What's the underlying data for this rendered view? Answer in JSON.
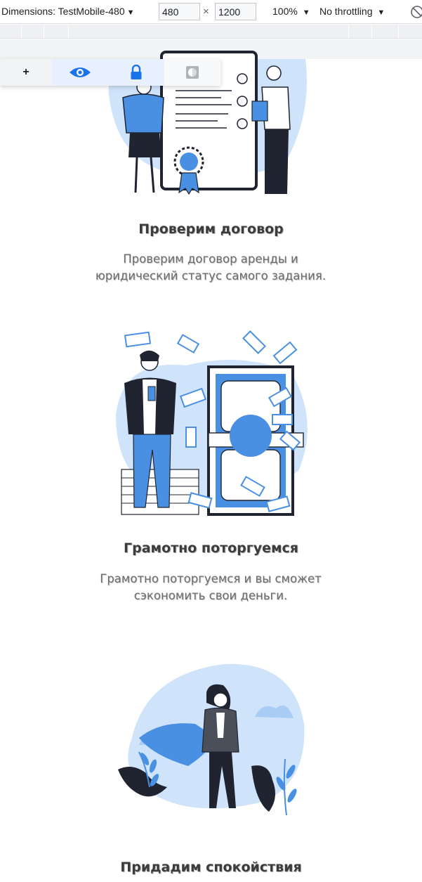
{
  "devtools": {
    "dimensions_label": "Dimensions: TestMobile-480",
    "width_value": "480",
    "height_value": "1200",
    "times": "×",
    "zoom": "100%",
    "throttling": "No throttling",
    "dropdown_arrow": "▼"
  },
  "tools": {
    "plus_label": "+",
    "items": [
      "plus-icon",
      "eye-icon",
      "lock-icon",
      "contrast-icon"
    ]
  },
  "features": [
    {
      "title": "Проверим договор",
      "desc_line1": "Проверим договор аренды и",
      "desc_line2": "юридический статус самого задания."
    },
    {
      "title": "Грамотно поторгуемся",
      "desc_line1": "Грамотно поторгуемся и вы сможет",
      "desc_line2": "сэкономить свои деньги."
    },
    {
      "title": "Придадим спокойствия"
    }
  ],
  "colors": {
    "accent": "#1a73e8",
    "illustration_blue": "#4a90e2",
    "illustration_light": "#cfe3fb",
    "ink": "#1f2430"
  }
}
